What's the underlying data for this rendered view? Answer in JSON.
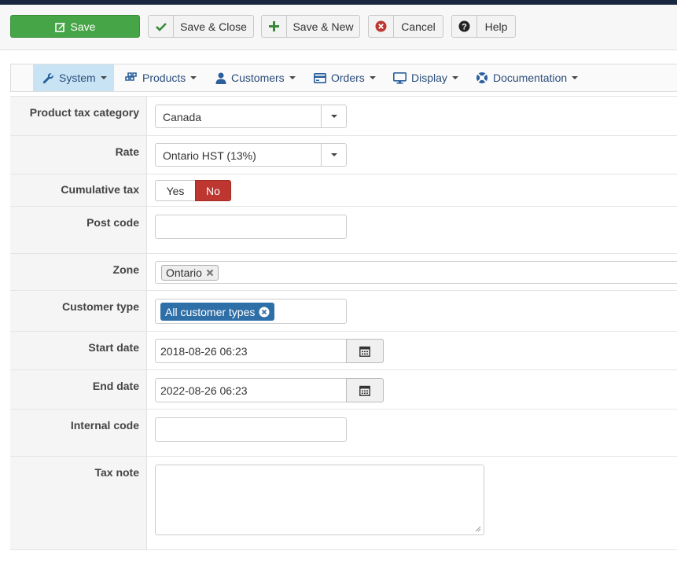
{
  "toolbar": {
    "save": "Save",
    "save_close": "Save & Close",
    "save_new": "Save & New",
    "cancel": "Cancel",
    "help": "Help"
  },
  "nav": [
    {
      "label": "System",
      "icon": "wrench-icon",
      "active": true
    },
    {
      "label": "Products",
      "icon": "cubes-icon"
    },
    {
      "label": "Customers",
      "icon": "user-icon"
    },
    {
      "label": "Orders",
      "icon": "credit-card-icon"
    },
    {
      "label": "Display",
      "icon": "monitor-icon"
    },
    {
      "label": "Documentation",
      "icon": "lifebuoy-icon"
    }
  ],
  "form": {
    "product_tax_category": {
      "label": "Product tax category",
      "value": "Canada"
    },
    "rate": {
      "label": "Rate",
      "value": "Ontario HST (13%)"
    },
    "cumulative_tax": {
      "label": "Cumulative tax",
      "yes": "Yes",
      "no": "No",
      "selected": "No"
    },
    "post_code": {
      "label": "Post code",
      "value": ""
    },
    "zone": {
      "label": "Zone",
      "tags": [
        "Ontario"
      ]
    },
    "customer_type": {
      "label": "Customer type",
      "tags": [
        "All customer types"
      ]
    },
    "start_date": {
      "label": "Start date",
      "value": "2018-08-26 06:23"
    },
    "end_date": {
      "label": "End date",
      "value": "2022-08-26 06:23"
    },
    "internal_code": {
      "label": "Internal code",
      "value": ""
    },
    "tax_note": {
      "label": "Tax note",
      "value": ""
    }
  },
  "colors": {
    "save_green": "#46a546",
    "no_red": "#bd362f",
    "tag_blue": "#2f6fa7",
    "nav_active": "#c8e4f4"
  }
}
